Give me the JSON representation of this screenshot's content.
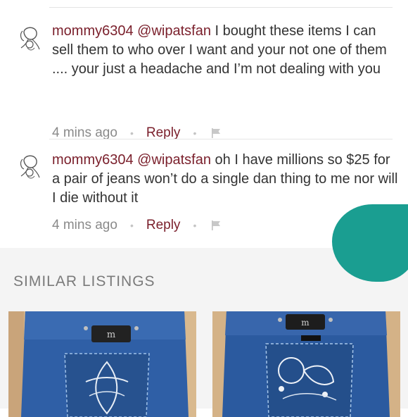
{
  "comments": [
    {
      "username": "mommy6304",
      "mention": "@wipatsfan",
      "text": "I bought these items I can sell them to who over I want and your not one of them .... your just a headache and I’m not dealing with you",
      "time": "4 mins ago",
      "reply_label": "Reply",
      "flag_icon": "flag-icon"
    },
    {
      "username": "mommy6304",
      "mention": "@wipatsfan",
      "text": "oh I have millions so $25 for a pair of jeans won’t do a single dan thing to me nor will I die without it",
      "time": "4 mins ago",
      "reply_label": "Reply",
      "flag_icon": "flag-icon"
    }
  ],
  "similar": {
    "title": "SIMILAR LISTINGS"
  },
  "colors": {
    "username": "#7a1f2b",
    "reply": "#7a1f2b",
    "meta": "#8a8a8a",
    "section_bg": "#f4f4f4",
    "denim": "#2f5fa6",
    "teal_overlay": "#1a9e91"
  }
}
